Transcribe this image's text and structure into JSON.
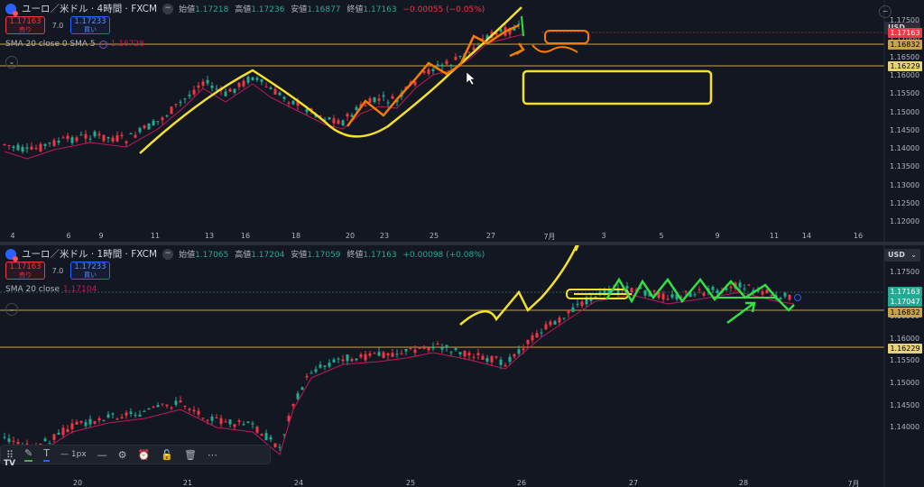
{
  "top": {
    "title": "ユーロ／米ドル · 4時間 · FXCM",
    "ohlc": [
      {
        "label": "始値",
        "value": "1.17218"
      },
      {
        "label": "高値",
        "value": "1.17236"
      },
      {
        "label": "安値",
        "value": "1.16877"
      },
      {
        "label": "終値",
        "value": "1.17163"
      }
    ],
    "change": "−0.00055 (−0.05%)",
    "sell": {
      "price": "1.17163",
      "label": "売り"
    },
    "buy": {
      "price": "1.17233",
      "label": "買い"
    },
    "spread": "7.0",
    "indicator": "SMA 20 close 0 SMA 5",
    "indicator_value": "1.16728",
    "currency": "USD",
    "price_axis": [
      "1.17500",
      "1.17000",
      "1.16500",
      "1.16000",
      "1.15500",
      "1.15000",
      "1.14500",
      "1.14000",
      "1.13500",
      "1.13000",
      "1.12500",
      "1.12000"
    ],
    "badges": [
      "1.17163",
      "1.16832",
      "1.16229"
    ],
    "dates": [
      "4",
      "6",
      "9",
      "11",
      "13",
      "16",
      "18",
      "20",
      "23",
      "25",
      "27",
      "7月",
      "3",
      "5",
      "9",
      "11",
      "14",
      "16"
    ]
  },
  "bottom": {
    "title": "ユーロ／米ドル · 1時間 · FXCM",
    "ohlc": [
      {
        "label": "始値",
        "value": "1.17065"
      },
      {
        "label": "高値",
        "value": "1.17204"
      },
      {
        "label": "安値",
        "value": "1.17059"
      },
      {
        "label": "終値",
        "value": "1.17163"
      }
    ],
    "change": "+0.00098 (+0.08%)",
    "sell": {
      "price": "1.17163",
      "label": "売り"
    },
    "buy": {
      "price": "1.17233",
      "label": "買い"
    },
    "spread": "7.0",
    "indicator": "SMA 20 close",
    "indicator_value": "1.17104",
    "currency": "USD",
    "price_axis": [
      "1.17500",
      "1.17000",
      "1.16500",
      "1.16000",
      "1.15500",
      "1.15000",
      "1.14500",
      "1.14000"
    ],
    "badges": [
      "1.17163",
      "1.17047",
      "1.16832",
      "1.16229"
    ],
    "dates": [
      "20",
      "21",
      "24",
      "25",
      "26",
      "27",
      "28",
      "7月"
    ]
  },
  "toolbar": {
    "width_label": "1px"
  },
  "logo": "TV",
  "colors": {
    "up": "#22ab94",
    "down": "#f23645",
    "sma": "#c2185b",
    "yellow": "#f5e12b",
    "orange": "#f57c00",
    "green": "#33e043",
    "level_line": "#c8a34b"
  },
  "icons": [
    "pencil-icon",
    "text-icon",
    "line-icon",
    "fill-icon",
    "alert-icon",
    "lock-icon",
    "trash-icon",
    "more-icon",
    "dots-icon"
  ]
}
